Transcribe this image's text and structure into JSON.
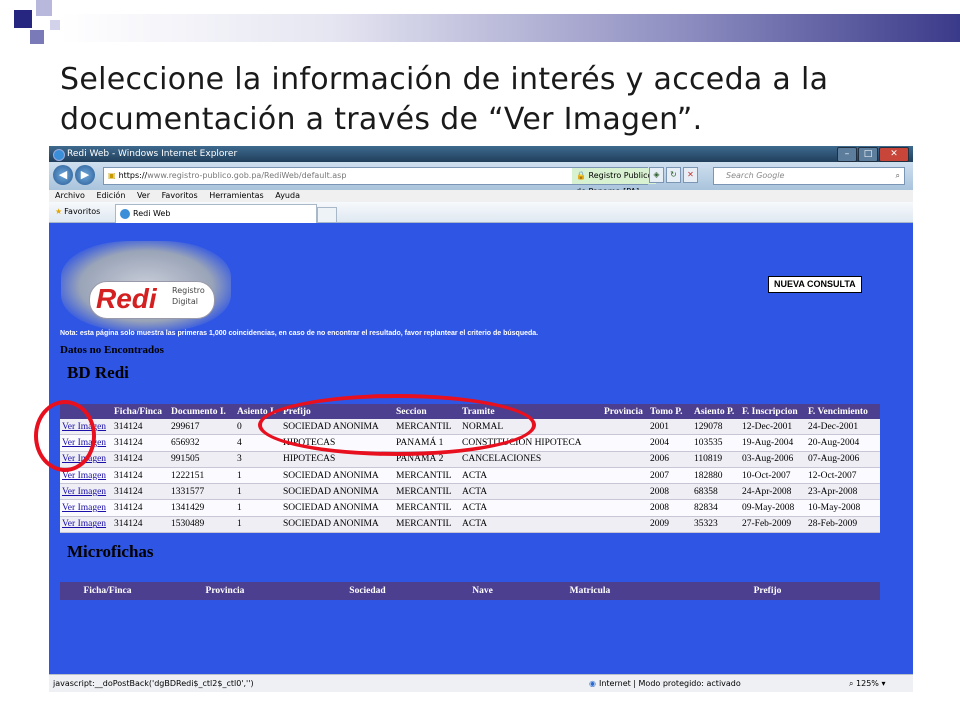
{
  "slide": {
    "title": "Seleccione la información de interés y acceda a la documentación a través de “Ver Imagen”."
  },
  "browser": {
    "window_title": "Redi Web - Windows Internet Explorer",
    "url_scheme": "https://",
    "url_host": "www.registro-publico.gob.pa",
    "url_path": "/RediWeb/default.asp",
    "certificate_label": "Registro Publico de Panama [PA]",
    "search_placeholder": "Search Google",
    "menu": [
      "Archivo",
      "Edición",
      "Ver",
      "Favoritos",
      "Herramientas",
      "Ayuda"
    ],
    "favorites_label": "Favoritos",
    "tab_label": "Redi Web",
    "status_text": "javascript:__doPostBack('dgBDRedi$_ctl2$_ctl0','')",
    "zone_text": "Internet | Modo protegido: activado",
    "zoom": "125%"
  },
  "page": {
    "logo_text": "Redi",
    "logo_line1": "Registro",
    "logo_line2": "Digital",
    "nueva_consulta": "NUEVA CONSULTA",
    "note": "Nota: esta página solo muestra las primeras 1,000 coincidencias, en caso de no encontrar el resultado, favor replantear el criterio de búsqueda.",
    "no_data": "Datos no Encontrados",
    "section_bd": "BD Redi",
    "section_micro": "Microfichas"
  },
  "bd_table": {
    "headers": [
      "",
      "Ficha/Finca",
      "Documento I.",
      "Asiento I.",
      "Prefijo",
      "Seccion",
      "Tramite",
      "Provincia",
      "Tomo P.",
      "Asiento P.",
      "F. Inscripcion",
      "F. Vencimiento"
    ],
    "rows": [
      [
        "Ver Imagen",
        "314124",
        "299617",
        "0",
        "SOCIEDAD ANONIMA",
        "MERCANTIL",
        "NORMAL",
        "",
        "2001",
        "129078",
        "12-Dec-2001",
        "24-Dec-2001"
      ],
      [
        "Ver Imagen",
        "314124",
        "656932",
        "4",
        "HIPOTECAS",
        "PANAMÁ 1",
        "CONSTITUCION HIPOTECA",
        "",
        "2004",
        "103535",
        "19-Aug-2004",
        "20-Aug-2004"
      ],
      [
        "Ver Imagen",
        "314124",
        "991505",
        "3",
        "HIPOTECAS",
        "PANAMÁ 2",
        "CANCELACIONES",
        "",
        "2006",
        "110819",
        "03-Aug-2006",
        "07-Aug-2006"
      ],
      [
        "Ver Imagen",
        "314124",
        "1222151",
        "1",
        "SOCIEDAD ANONIMA",
        "MERCANTIL",
        "ACTA",
        "",
        "2007",
        "182880",
        "10-Oct-2007",
        "12-Oct-2007"
      ],
      [
        "Ver Imagen",
        "314124",
        "1331577",
        "1",
        "SOCIEDAD ANONIMA",
        "MERCANTIL",
        "ACTA",
        "",
        "2008",
        "68358",
        "24-Apr-2008",
        "23-Apr-2008"
      ],
      [
        "Ver Imagen",
        "314124",
        "1341429",
        "1",
        "SOCIEDAD ANONIMA",
        "MERCANTIL",
        "ACTA",
        "",
        "2008",
        "82834",
        "09-May-2008",
        "10-May-2008"
      ],
      [
        "Ver Imagen",
        "314124",
        "1530489",
        "1",
        "SOCIEDAD ANONIMA",
        "MERCANTIL",
        "ACTA",
        "",
        "2009",
        "35323",
        "27-Feb-2009",
        "28-Feb-2009"
      ]
    ]
  },
  "micro_table": {
    "headers": [
      "Ficha/Finca",
      "Provincia",
      "Sociedad",
      "Nave",
      "Matricula",
      "Prefijo"
    ]
  },
  "colors": {
    "page_background": "#2f55e4",
    "table_header": "#4d3f8f",
    "annotation": "#e8101e"
  }
}
